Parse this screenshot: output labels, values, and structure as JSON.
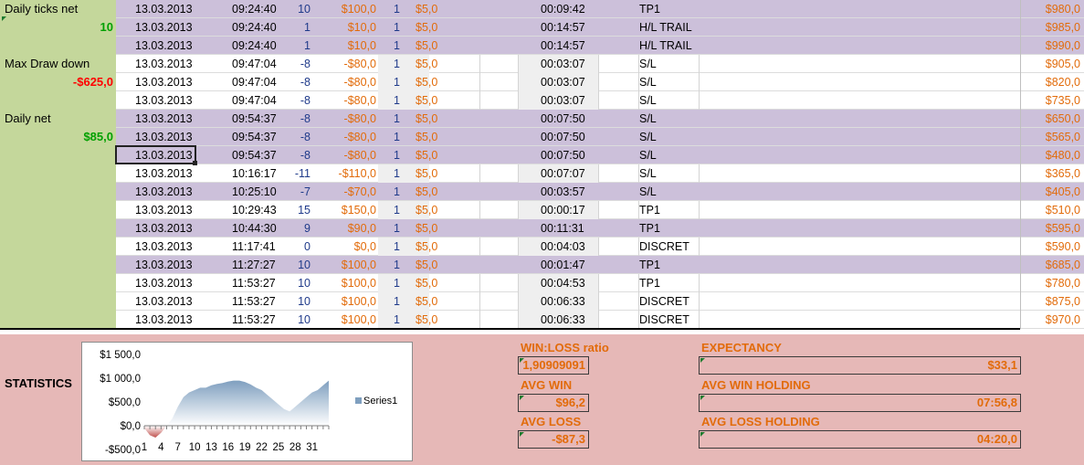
{
  "summary": {
    "daily_ticks_label": "Daily ticks net",
    "daily_ticks_value": "10",
    "max_dd_label": "Max Draw down",
    "max_dd_value": "-$625,0",
    "daily_net_label": "Daily net",
    "daily_net_value": "$85,0"
  },
  "rows": [
    {
      "date": "13.03.2013",
      "time": "09:24:40",
      "ticks": "10",
      "amount": "$100,0",
      "qty": "1",
      "fee": "$5,0",
      "duration": "00:09:42",
      "result": "TP1",
      "balance": "$980,0",
      "shade": "p"
    },
    {
      "date": "13.03.2013",
      "time": "09:24:40",
      "ticks": "1",
      "amount": "$10,0",
      "qty": "1",
      "fee": "$5,0",
      "duration": "00:14:57",
      "result": "H/L TRAIL",
      "balance": "$985,0",
      "shade": "p"
    },
    {
      "date": "13.03.2013",
      "time": "09:24:40",
      "ticks": "1",
      "amount": "$10,0",
      "qty": "1",
      "fee": "$5,0",
      "duration": "00:14:57",
      "result": "H/L TRAIL",
      "balance": "$990,0",
      "shade": "p"
    },
    {
      "date": "13.03.2013",
      "time": "09:47:04",
      "ticks": "-8",
      "amount": "-$80,0",
      "qty": "1",
      "fee": "$5,0",
      "duration": "00:03:07",
      "result": "S/L",
      "balance": "$905,0",
      "shade": "w"
    },
    {
      "date": "13.03.2013",
      "time": "09:47:04",
      "ticks": "-8",
      "amount": "-$80,0",
      "qty": "1",
      "fee": "$5,0",
      "duration": "00:03:07",
      "result": "S/L",
      "balance": "$820,0",
      "shade": "w"
    },
    {
      "date": "13.03.2013",
      "time": "09:47:04",
      "ticks": "-8",
      "amount": "-$80,0",
      "qty": "1",
      "fee": "$5,0",
      "duration": "00:03:07",
      "result": "S/L",
      "balance": "$735,0",
      "shade": "w"
    },
    {
      "date": "13.03.2013",
      "time": "09:54:37",
      "ticks": "-8",
      "amount": "-$80,0",
      "qty": "1",
      "fee": "$5,0",
      "duration": "00:07:50",
      "result": "S/L",
      "balance": "$650,0",
      "shade": "p"
    },
    {
      "date": "13.03.2013",
      "time": "09:54:37",
      "ticks": "-8",
      "amount": "-$80,0",
      "qty": "1",
      "fee": "$5,0",
      "duration": "00:07:50",
      "result": "S/L",
      "balance": "$565,0",
      "shade": "p"
    },
    {
      "date": "13.03.2013",
      "time": "09:54:37",
      "ticks": "-8",
      "amount": "-$80,0",
      "qty": "1",
      "fee": "$5,0",
      "duration": "00:07:50",
      "result": "S/L",
      "balance": "$480,0",
      "shade": "p"
    },
    {
      "date": "13.03.2013",
      "time": "10:16:17",
      "ticks": "-11",
      "amount": "-$110,0",
      "qty": "1",
      "fee": "$5,0",
      "duration": "00:07:07",
      "result": "S/L",
      "balance": "$365,0",
      "shade": "w"
    },
    {
      "date": "13.03.2013",
      "time": "10:25:10",
      "ticks": "-7",
      "amount": "-$70,0",
      "qty": "1",
      "fee": "$5,0",
      "duration": "00:03:57",
      "result": "S/L",
      "balance": "$405,0",
      "shade": "p"
    },
    {
      "date": "13.03.2013",
      "time": "10:29:43",
      "ticks": "15",
      "amount": "$150,0",
      "qty": "1",
      "fee": "$5,0",
      "duration": "00:00:17",
      "result": "TP1",
      "balance": "$510,0",
      "shade": "w"
    },
    {
      "date": "13.03.2013",
      "time": "10:44:30",
      "ticks": "9",
      "amount": "$90,0",
      "qty": "1",
      "fee": "$5,0",
      "duration": "00:11:31",
      "result": "TP1",
      "balance": "$595,0",
      "shade": "p"
    },
    {
      "date": "13.03.2013",
      "time": "11:17:41",
      "ticks": "0",
      "amount": "$0,0",
      "qty": "1",
      "fee": "$5,0",
      "duration": "00:04:03",
      "result": "DISCRET",
      "balance": "$590,0",
      "shade": "w"
    },
    {
      "date": "13.03.2013",
      "time": "11:27:27",
      "ticks": "10",
      "amount": "$100,0",
      "qty": "1",
      "fee": "$5,0",
      "duration": "00:01:47",
      "result": "TP1",
      "balance": "$685,0",
      "shade": "p"
    },
    {
      "date": "13.03.2013",
      "time": "11:53:27",
      "ticks": "10",
      "amount": "$100,0",
      "qty": "1",
      "fee": "$5,0",
      "duration": "00:04:53",
      "result": "TP1",
      "balance": "$780,0",
      "shade": "w"
    },
    {
      "date": "13.03.2013",
      "time": "11:53:27",
      "ticks": "10",
      "amount": "$100,0",
      "qty": "1",
      "fee": "$5,0",
      "duration": "00:06:33",
      "result": "DISCRET",
      "balance": "$875,0",
      "shade": "w"
    },
    {
      "date": "13.03.2013",
      "time": "11:53:27",
      "ticks": "10",
      "amount": "$100,0",
      "qty": "1",
      "fee": "$5,0",
      "duration": "00:06:33",
      "result": "DISCRET",
      "balance": "$970,0",
      "shade": "w"
    }
  ],
  "stats": {
    "title": "STATISTICS",
    "win_loss_label": "WIN:LOSS ratio",
    "win_loss_value": "1,90909091",
    "avg_win_label": "AVG WIN",
    "avg_win_value": "$96,2",
    "avg_loss_label": "AVG LOSS",
    "avg_loss_value": "-$87,3",
    "expectancy_label": "EXPECTANCY",
    "expectancy_value": "$33,1",
    "avg_win_holding_label": "AVG WIN HOLDING",
    "avg_win_holding_value": "07:56,8",
    "avg_loss_holding_label": "AVG LOSS HOLDING",
    "avg_loss_holding_value": "04:20,0"
  },
  "chart_data": {
    "type": "area",
    "x": [
      1,
      2,
      3,
      4,
      5,
      6,
      7,
      8,
      9,
      10,
      11,
      12,
      13,
      14,
      15,
      16,
      17,
      18,
      19,
      20,
      21,
      22,
      23,
      24,
      25,
      26,
      27,
      28,
      29,
      30,
      31,
      32,
      33,
      34
    ],
    "series": [
      {
        "name": "Series1",
        "values": [
          -50,
          -200,
          -250,
          -150,
          0,
          150,
          400,
          600,
          700,
          750,
          800,
          800,
          850,
          880,
          900,
          930,
          950,
          950,
          920,
          870,
          800,
          750,
          650,
          550,
          450,
          350,
          300,
          400,
          500,
          600,
          700,
          750,
          850,
          950
        ]
      }
    ],
    "ylim": [
      -500,
      1500
    ],
    "yticks": [
      "$1 500,0",
      "$1 000,0",
      "$500,0",
      "$0,0",
      "-$500,0"
    ],
    "xticks": [
      "1",
      "4",
      "7",
      "10",
      "13",
      "16",
      "19",
      "22",
      "25",
      "28",
      "31"
    ],
    "legend": "right",
    "grid": false,
    "colors": {
      "positive": "#7f9fbf",
      "negative": "#c0504d"
    }
  }
}
